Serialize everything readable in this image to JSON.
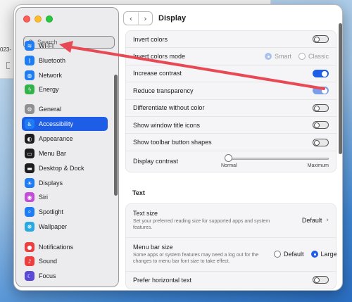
{
  "background": {
    "doc_text": "023-"
  },
  "sidebar": {
    "search_placeholder": "Search",
    "items": [
      {
        "label": "Wi-Fi",
        "icon": "wifi-icon",
        "color": "#1e7cf5"
      },
      {
        "label": "Bluetooth",
        "icon": "bluetooth-icon",
        "color": "#1e7cf5"
      },
      {
        "label": "Network",
        "icon": "globe-icon",
        "color": "#1e7cf5"
      },
      {
        "label": "Energy",
        "icon": "bolt-icon",
        "color": "#33b24a"
      },
      {
        "label": "General",
        "icon": "gear-icon",
        "color": "#8e8e93"
      },
      {
        "label": "Accessibility",
        "icon": "accessibility-icon",
        "color": "#1e7cf5",
        "selected": true
      },
      {
        "label": "Appearance",
        "icon": "appearance-icon",
        "color": "#1d1d1f"
      },
      {
        "label": "Menu Bar",
        "icon": "menu-bar-icon",
        "color": "#1d1d1f"
      },
      {
        "label": "Desktop & Dock",
        "icon": "dock-icon",
        "color": "#1d1d1f"
      },
      {
        "label": "Displays",
        "icon": "display-icon",
        "color": "#1e7cf5"
      },
      {
        "label": "Siri",
        "icon": "siri-icon",
        "color": "#c34fd9"
      },
      {
        "label": "Spotlight",
        "icon": "spotlight-icon",
        "color": "#1e7cf5"
      },
      {
        "label": "Wallpaper",
        "icon": "wallpaper-icon",
        "color": "#28a9e0"
      },
      {
        "label": "Notifications",
        "icon": "bell-icon",
        "color": "#ef3e3e"
      },
      {
        "label": "Sound",
        "icon": "speaker-icon",
        "color": "#ef3e3e"
      },
      {
        "label": "Focus",
        "icon": "moon-icon",
        "color": "#5b4ad6"
      }
    ]
  },
  "toolbar": {
    "title": "Display",
    "back": "‹",
    "forward": "›"
  },
  "display": {
    "invert_colors": "Invert colors",
    "invert_colors_mode": "Invert colors mode",
    "mode_smart": "Smart",
    "mode_classic": "Classic",
    "increase_contrast": "Increase contrast",
    "reduce_transparency": "Reduce transparency",
    "differentiate": "Differentiate without color",
    "show_title_icons": "Show window title icons",
    "show_toolbar_shapes": "Show toolbar button shapes",
    "display_contrast": "Display contrast",
    "contrast_min": "Normal",
    "contrast_max": "Maximum",
    "contrast_level": 0
  },
  "text_section": {
    "heading": "Text",
    "text_size": "Text size",
    "text_size_desc": "Set your preferred reading size for supported apps and system features.",
    "text_size_value": "Default",
    "menu_bar_size": "Menu bar size",
    "menu_bar_desc": "Some apps or system features may need a log out for the changes to menu bar font size to take effect.",
    "menu_default": "Default",
    "menu_large": "Large",
    "prefer_horizontal": "Prefer horizontal text"
  },
  "colors": {
    "accent": "#1e5ee6",
    "annotation_arrow": "#e84a55"
  }
}
